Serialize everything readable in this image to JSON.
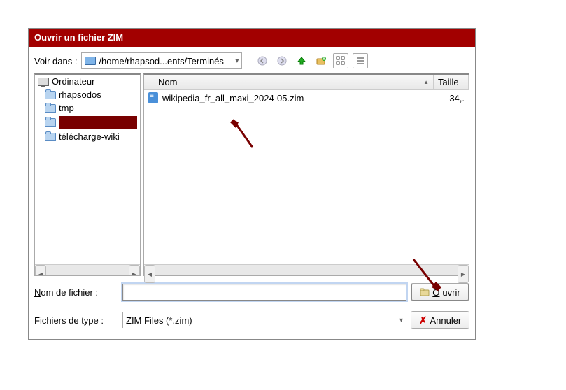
{
  "title": "Ouvrir un fichier ZIM",
  "look_in_label": "Voir dans :",
  "path": "/home/rhapsod...ents/Terminés",
  "columns": {
    "name": "Nom",
    "size": "Taille"
  },
  "places": [
    {
      "icon": "computer",
      "label": "Ordinateur"
    },
    {
      "icon": "folder",
      "label": "rhapsodos"
    },
    {
      "icon": "folder",
      "label": "tmp"
    },
    {
      "icon": "folder",
      "label": "",
      "redacted": true
    },
    {
      "icon": "folder",
      "label": "télécharge-wiki"
    }
  ],
  "files": [
    {
      "name": "wikipedia_fr_all_maxi_2024-05.zim",
      "size": "34,."
    }
  ],
  "filename_label": "Nom de fichier :",
  "filename_value": "",
  "filetype_label": "Fichiers de type :",
  "filetype_value": "ZIM Files (*.zim)",
  "open_label": "Ouvrir",
  "cancel_label": "Annuler"
}
